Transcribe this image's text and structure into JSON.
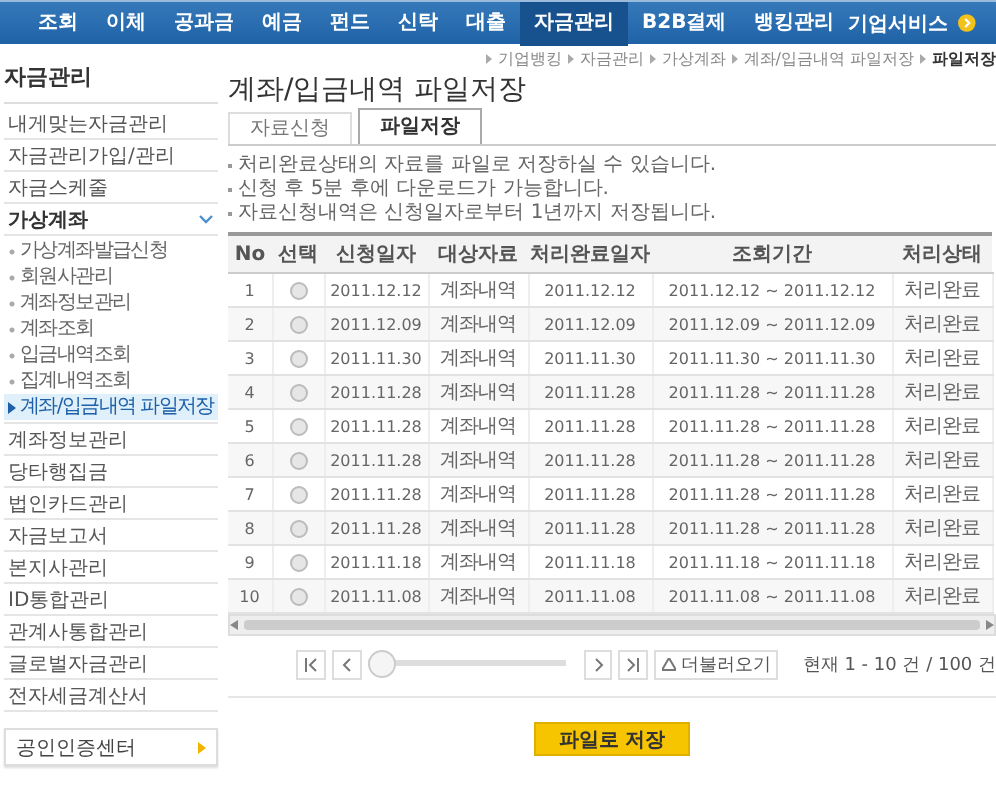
{
  "nav": {
    "items": [
      {
        "label": "조회",
        "selected": false
      },
      {
        "label": "이체",
        "selected": false
      },
      {
        "label": "공과금",
        "selected": false
      },
      {
        "label": "예금",
        "selected": false
      },
      {
        "label": "펀드",
        "selected": false
      },
      {
        "label": "신탁",
        "selected": false
      },
      {
        "label": "대출",
        "selected": false
      },
      {
        "label": "자금관리",
        "selected": true
      },
      {
        "label": "B2B결제",
        "selected": false
      },
      {
        "label": "뱅킹관리",
        "selected": false
      }
    ],
    "service": "기업서비스"
  },
  "breadcrumb": [
    "기업뱅킹",
    "자금관리",
    "가상계좌",
    "계좌/입금내역 파일저장",
    "파일저장"
  ],
  "sidebar": {
    "title": "자금관리",
    "items": [
      {
        "label": "내게맞는자금관리"
      },
      {
        "label": "자금관리가입/관리"
      },
      {
        "label": "자금스케줄"
      },
      {
        "label": "가상계좌",
        "expanded": true,
        "children": [
          {
            "label": "가상계좌발급신청",
            "selected": false
          },
          {
            "label": "회원사관리",
            "selected": false
          },
          {
            "label": "계좌정보관리",
            "selected": false
          },
          {
            "label": "계좌조회",
            "selected": false
          },
          {
            "label": "입금내역조회",
            "selected": false
          },
          {
            "label": "집계내역조회",
            "selected": false
          },
          {
            "label": "계좌/입금내역 파일저장",
            "selected": true
          }
        ]
      },
      {
        "label": "계좌정보관리"
      },
      {
        "label": "당타행집금"
      },
      {
        "label": "법인카드관리"
      },
      {
        "label": "자금보고서"
      },
      {
        "label": "본지사관리"
      },
      {
        "label": "ID통합관리"
      },
      {
        "label": "관계사통합관리"
      },
      {
        "label": "글로벌자금관리"
      },
      {
        "label": "전자세금계산서"
      }
    ],
    "cert_button": "공인인증센터"
  },
  "page_title": "계좌/입금내역 파일저장",
  "tabs": [
    {
      "label": "자료신청",
      "selected": false
    },
    {
      "label": "파일저장",
      "selected": true
    }
  ],
  "notes": [
    "처리완료상태의 자료를 파일로 저장하실 수 있습니다.",
    "신청 후 5분 후에 다운로드가 가능합니다.",
    "자료신청내역은 신청일자로부터 1년까지 저장됩니다."
  ],
  "table": {
    "columns": [
      "No",
      "선택",
      "신청일자",
      "대상자료",
      "처리완료일자",
      "조회기간",
      "처리상태"
    ],
    "rows": [
      {
        "cells": [
          "1",
          "",
          "2011.12.12",
          "계좌내역",
          "2011.12.12",
          "2011.12.12 ~ 2011.12.12",
          "처리완료"
        ],
        "selected": false
      },
      {
        "cells": [
          "2",
          "",
          "2011.12.09",
          "계좌내역",
          "2011.12.09",
          "2011.12.09 ~ 2011.12.09",
          "처리완료"
        ],
        "selected": false
      },
      {
        "cells": [
          "3",
          "",
          "2011.11.30",
          "계좌내역",
          "2011.11.30",
          "2011.11.30 ~ 2011.11.30",
          "처리완료"
        ],
        "selected": false
      },
      {
        "cells": [
          "4",
          "",
          "2011.11.28",
          "계좌내역",
          "2011.11.28",
          "2011.11.28 ~ 2011.11.28",
          "처리완료"
        ],
        "selected": false
      },
      {
        "cells": [
          "5",
          "",
          "2011.11.28",
          "계좌내역",
          "2011.11.28",
          "2011.11.28 ~ 2011.11.28",
          "처리완료"
        ],
        "selected": false
      },
      {
        "cells": [
          "6",
          "",
          "2011.11.28",
          "계좌내역",
          "2011.11.28",
          "2011.11.28 ~ 2011.11.28",
          "처리완료"
        ],
        "selected": false
      },
      {
        "cells": [
          "7",
          "",
          "2011.11.28",
          "계좌내역",
          "2011.11.28",
          "2011.11.28 ~ 2011.11.28",
          "처리완료"
        ],
        "selected": false
      },
      {
        "cells": [
          "8",
          "",
          "2011.11.28",
          "계좌내역",
          "2011.11.28",
          "2011.11.28 ~ 2011.11.28",
          "처리완료"
        ],
        "selected": false
      },
      {
        "cells": [
          "9",
          "",
          "2011.11.18",
          "계좌내역",
          "2011.11.18",
          "2011.11.18 ~ 2011.11.18",
          "처리완료"
        ],
        "selected": false
      },
      {
        "cells": [
          "10",
          "",
          "2011.11.08",
          "계좌내역",
          "2011.11.08",
          "2011.11.08 ~ 2011.11.08",
          "처리완료"
        ],
        "selected": false
      }
    ]
  },
  "pager": {
    "level": 0,
    "more_button": "더불러오기",
    "status": "현재 1 - 10 건 / 100 건"
  },
  "save_button": "파일로 저장"
}
